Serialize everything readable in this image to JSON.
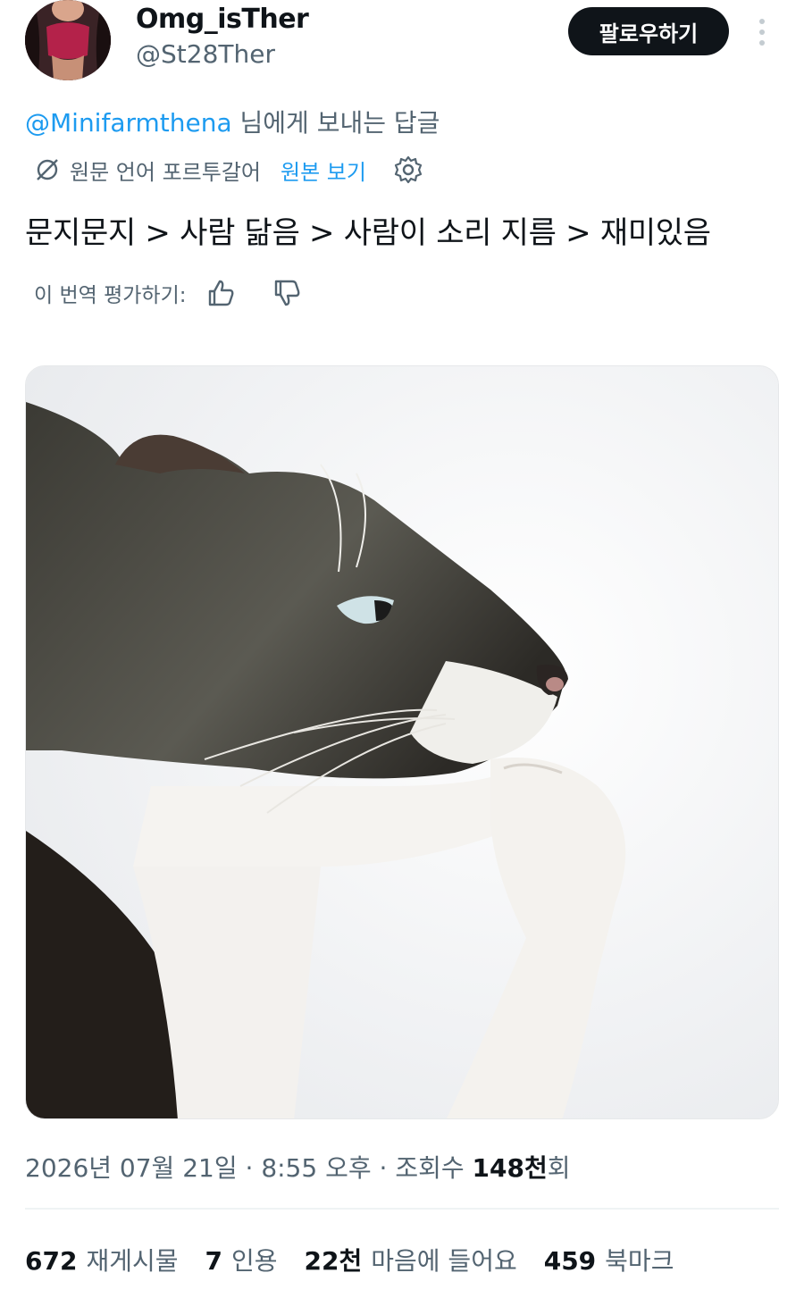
{
  "user": {
    "display_name": "Omg_isTher",
    "handle": "@St28Ther",
    "follow_label": "팔로우하기"
  },
  "reply": {
    "mention": "@Minifarmthena",
    "suffix": " 님에게 보내는 답글"
  },
  "translation": {
    "source_label": "원문 언어 포르투갈어",
    "show_original_label": "원본 보기"
  },
  "tweet": {
    "text": "문지문지 > 사람 닮음 > 사람이 소리 지름 > 재미있음"
  },
  "rate": {
    "label": "이 번역 평가하기:"
  },
  "meta": {
    "date": "2026년 07월 21일",
    "time": "8:55 오후",
    "views_prefix": "조회수 ",
    "views_value": "148천",
    "views_suffix": "회",
    "separator": " · "
  },
  "stats": {
    "retweets_num": "672",
    "retweets_label": "재게시물",
    "quotes_num": "7",
    "quotes_label": "인용",
    "likes_num": "22천",
    "likes_label": "마음에 들어요",
    "bookmarks_num": "459",
    "bookmarks_label": "북마크"
  },
  "icons": {
    "translate": "translate-icon",
    "settings": "gear-icon",
    "thumbs_up": "thumbs-up-icon",
    "thumbs_down": "thumbs-down-icon",
    "more": "more-vertical-icon"
  },
  "colors": {
    "link": "#1d9bf0",
    "secondary_text": "#536471",
    "follow_button": "#0f1419"
  }
}
